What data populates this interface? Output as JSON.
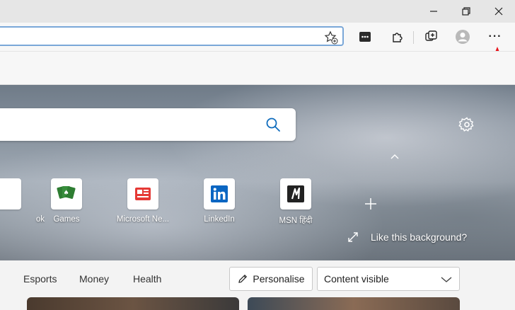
{
  "window": {
    "minimize_icon": "minimize-icon",
    "restore_icon": "restore-icon",
    "close_icon": "close-icon"
  },
  "addressbar": {
    "value": "",
    "favorite_icon": "favorite-add-icon"
  },
  "toolbar": {
    "icons": [
      "sidebar-app-icon",
      "extensions-icon",
      "collections-icon",
      "profile-icon"
    ],
    "more_label": "···"
  },
  "annotation": {
    "color": "#e8141c"
  },
  "newtab": {
    "search_placeholder": "",
    "tiles": [
      {
        "label": "ok"
      },
      {
        "label": "Games"
      },
      {
        "label": "Microsoft Ne..."
      },
      {
        "label": "LinkedIn"
      },
      {
        "label": "MSN हिंदी"
      }
    ],
    "like_background": "Like this background?"
  },
  "feed": {
    "nav": [
      "Esports",
      "Money",
      "Health"
    ],
    "personalise_label": "Personalise",
    "content_select": "Content visible"
  }
}
